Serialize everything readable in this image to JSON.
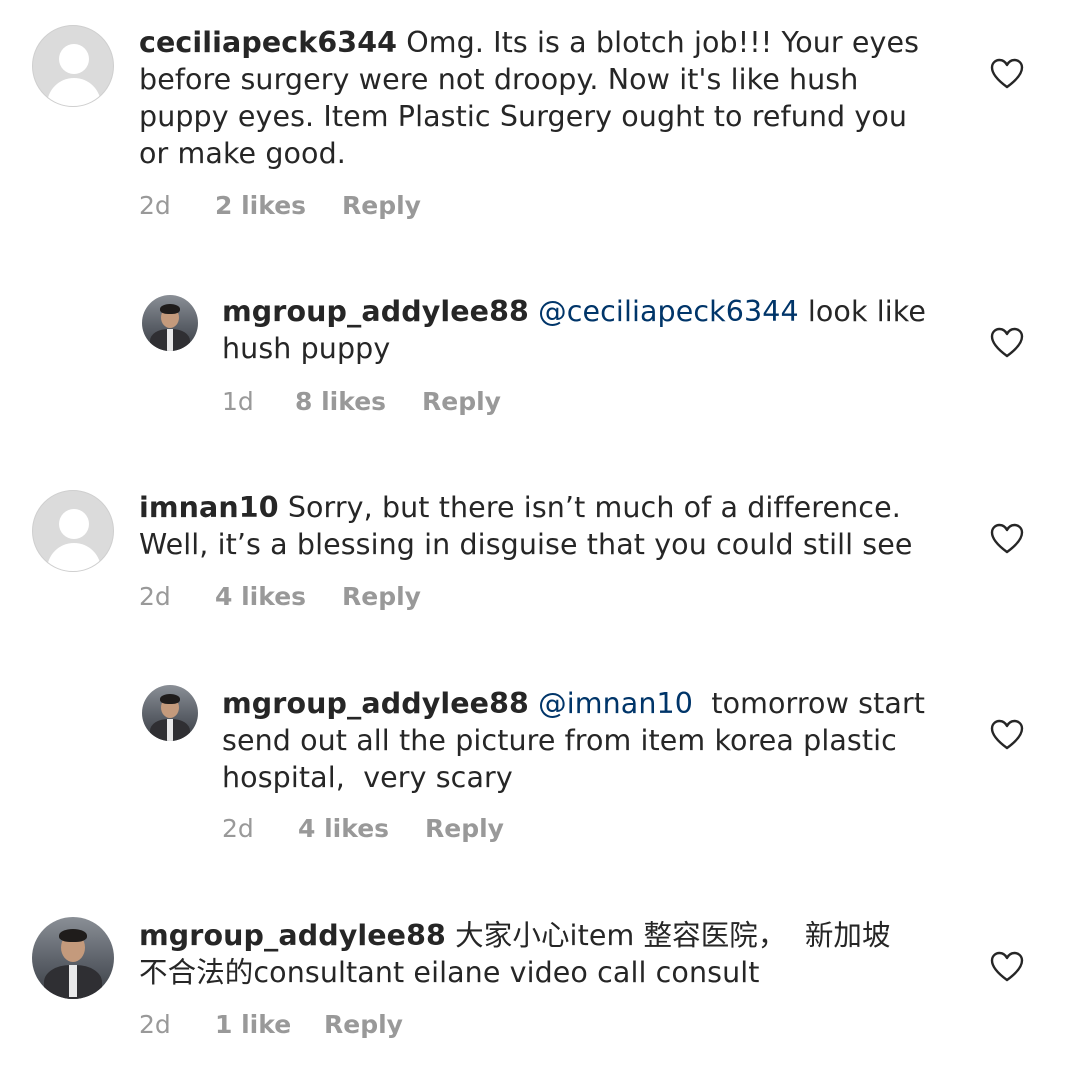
{
  "comments": [
    {
      "username": "ceciliapeck6344",
      "lines": [
        "Omg. Its is a blotch job!!! Your eyes",
        "before surgery were not droopy. Now it's like hush",
        "puppy eyes. Item Plastic Surgery ought to refund you",
        "or make good."
      ],
      "time": "2d",
      "likes": "2 likes",
      "reply_label": "Reply",
      "avatar": "default-avatar-icon"
    },
    {
      "username": "mgroup_addylee88",
      "mention": "@ceciliapeck6344",
      "lines": [
        "look like",
        "hush puppy"
      ],
      "time": "1d",
      "likes": "8 likes",
      "reply_label": "Reply",
      "avatar": "profile-photo"
    },
    {
      "username": "imnan10",
      "lines": [
        "Sorry, but there isn’t much of a difference.",
        "Well, it’s a blessing in disguise that you could still see"
      ],
      "time": "2d",
      "likes": "4 likes",
      "reply_label": "Reply",
      "avatar": "default-avatar-icon"
    },
    {
      "username": "mgroup_addylee88",
      "mention": "@imnan10",
      "lines": [
        " tomorrow start",
        "send out all the picture from item korea plastic",
        "hospital,  very scary"
      ],
      "time": "2d",
      "likes": "4 likes",
      "reply_label": "Reply",
      "avatar": "profile-photo"
    },
    {
      "username": "mgroup_addylee88",
      "lines": [
        "大家小心item 整容医院，  新加坡",
        "不合法的consultant eilane video call consult"
      ],
      "time": "2d",
      "likes": "1 like",
      "reply_label": "Reply",
      "avatar": "profile-photo"
    }
  ],
  "icons": {
    "like": "heart-outline-icon"
  },
  "colors": {
    "text": "#262626",
    "meta": "#999999",
    "mention": "#003569",
    "heart": "#262626"
  }
}
